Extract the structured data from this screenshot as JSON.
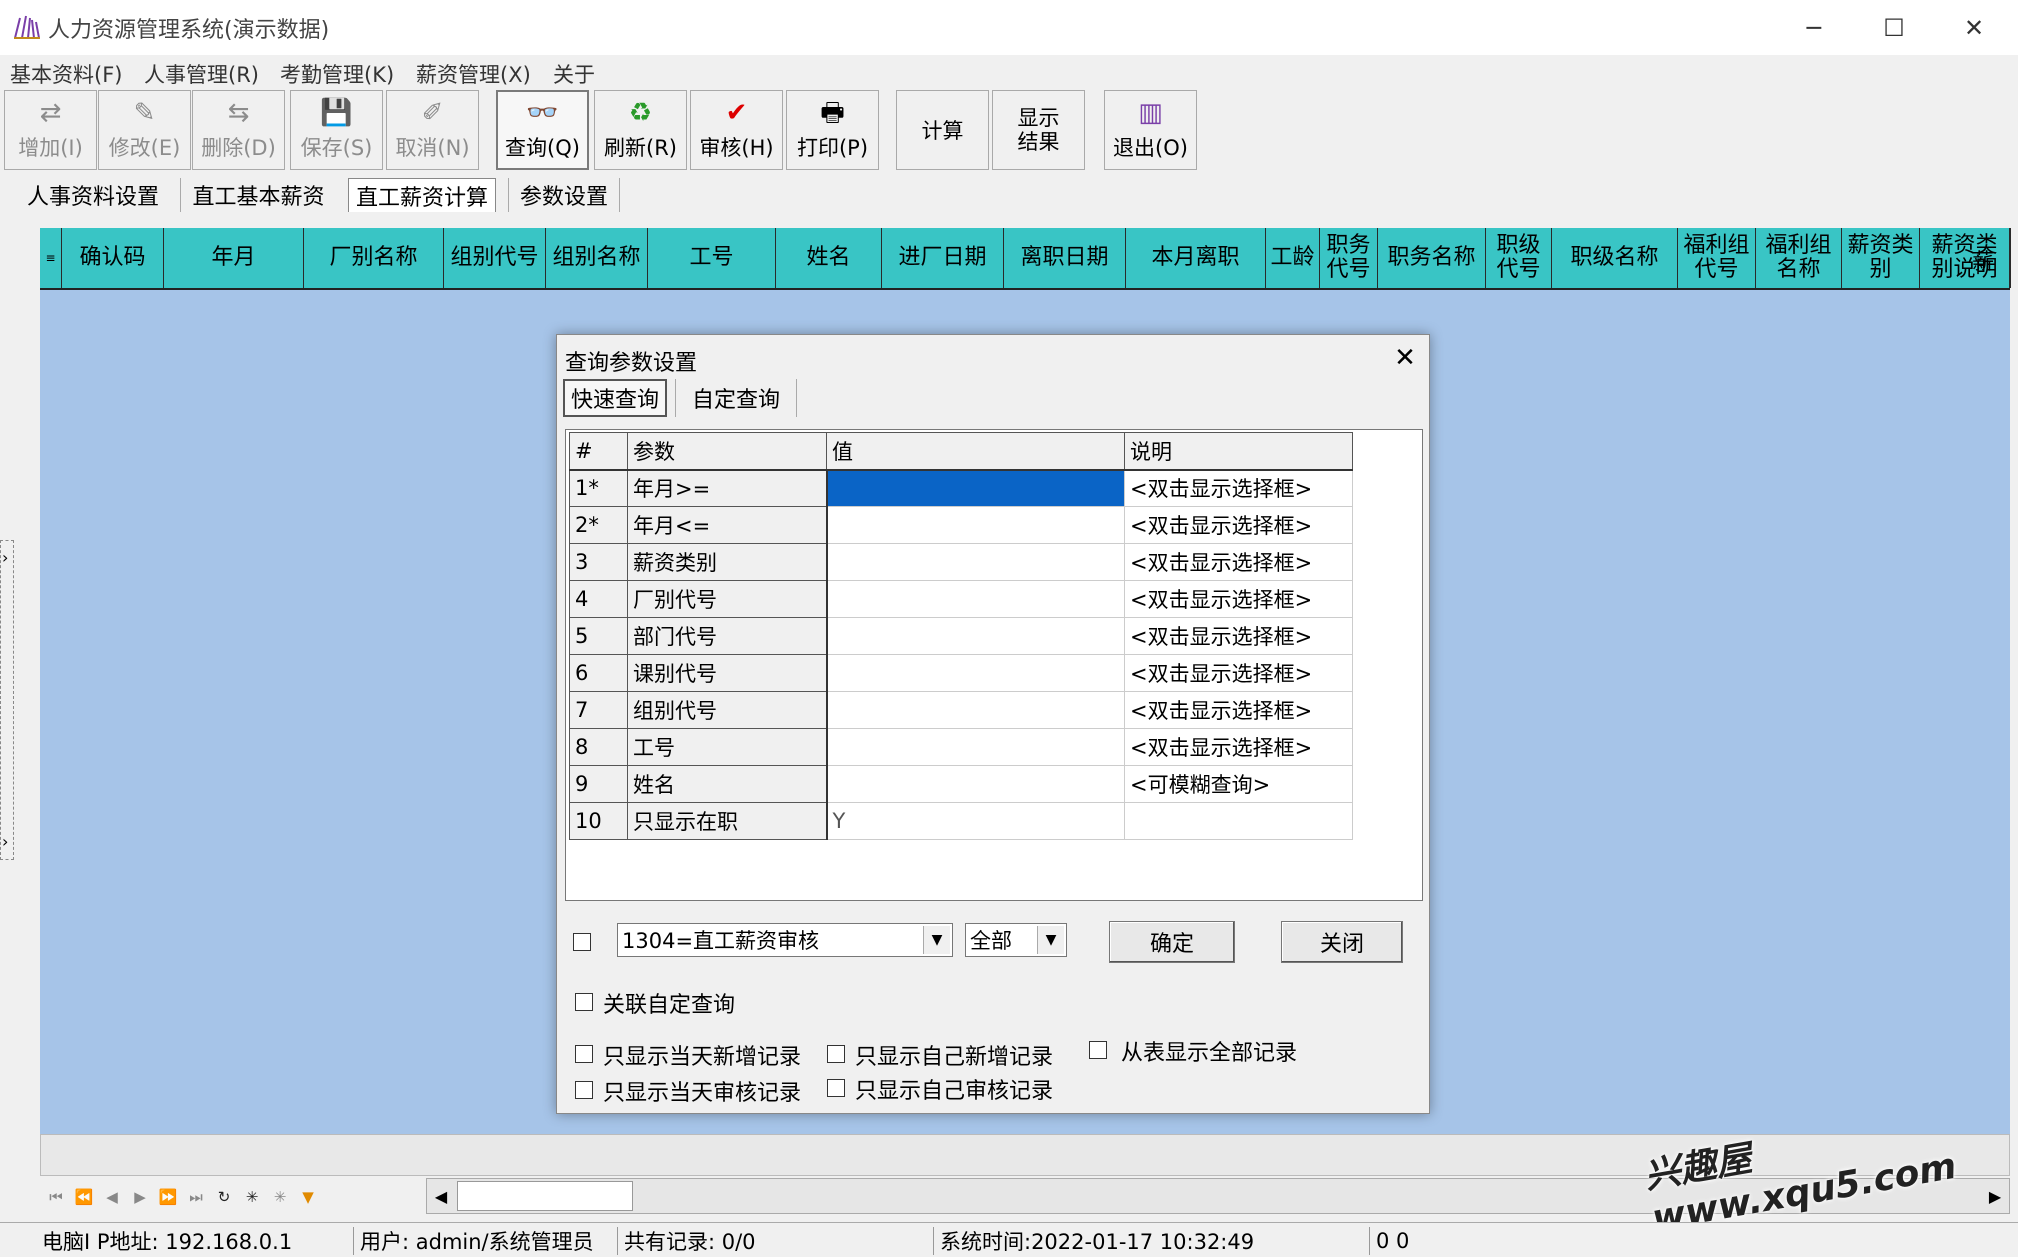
{
  "window": {
    "title": "人力资源管理系统(演示数据)",
    "min": "─",
    "max": "☐",
    "close": "✕"
  },
  "menu": [
    "基本资料(F)",
    "人事管理(R)",
    "考勤管理(K)",
    "薪资管理(X)",
    "关于"
  ],
  "toolbar": [
    {
      "label": "增加(I)",
      "icon": "add-icon",
      "glyph": "⇄",
      "disabled": true
    },
    {
      "label": "修改(E)",
      "icon": "edit-icon",
      "glyph": "✎",
      "disabled": true
    },
    {
      "label": "删除(D)",
      "icon": "delete-icon",
      "glyph": "⇆",
      "disabled": true
    },
    {
      "label": "保存(S)",
      "icon": "save-icon",
      "glyph": "💾",
      "disabled": true
    },
    {
      "label": "取消(N)",
      "icon": "cancel-icon",
      "glyph": "✐",
      "disabled": true
    },
    {
      "label": "查询(Q)",
      "icon": "binoculars-icon",
      "glyph": "👓",
      "disabled": false
    },
    {
      "label": "刷新(R)",
      "icon": "refresh-icon",
      "glyph": "♻",
      "disabled": false
    },
    {
      "label": "审核(H)",
      "icon": "check-icon",
      "glyph": "✔",
      "disabled": false
    },
    {
      "label": "打印(P)",
      "icon": "printer-icon",
      "glyph": "🖶",
      "disabled": false
    },
    {
      "label": "计算",
      "icon": "",
      "glyph": "",
      "disabled": false
    },
    {
      "label": "显示\n结果",
      "icon": "",
      "glyph": "",
      "disabled": false
    },
    {
      "label": "退出(O)",
      "icon": "exit-icon",
      "glyph": "▥",
      "disabled": false
    }
  ],
  "tabs": [
    "人事资料设置",
    "直工基本薪资",
    "直工薪资计算",
    "参数设置"
  ],
  "grid_columns": [
    "确认码",
    "年月",
    "厂别名称",
    "组别代号",
    "组别名称",
    "工号",
    "姓名",
    "进厂日期",
    "离职日期",
    "本月离职",
    "工龄",
    "职务\n代号",
    "职务名称",
    "职级\n代号",
    "职级名称",
    "福利组\n代号",
    "福利组\n名称",
    "薪资类\n别",
    "薪资类\n别说明",
    "薪"
  ],
  "dialog": {
    "title": "查询参数设置",
    "tabs": [
      "快速查询",
      "自定查询"
    ],
    "table_headers": [
      "#",
      "参数",
      "值",
      "说明"
    ],
    "rows": [
      {
        "num": "1*",
        "param": "年月>=",
        "value": "",
        "note": "<双击显示选择框>"
      },
      {
        "num": "2*",
        "param": "年月<=",
        "value": "",
        "note": "<双击显示选择框>"
      },
      {
        "num": "3",
        "param": "薪资类别",
        "value": "",
        "note": "<双击显示选择框>"
      },
      {
        "num": "4",
        "param": "厂别代号",
        "value": "",
        "note": "<双击显示选择框>"
      },
      {
        "num": "5",
        "param": "部门代号",
        "value": "",
        "note": "<双击显示选择框>"
      },
      {
        "num": "6",
        "param": "课别代号",
        "value": "",
        "note": "<双击显示选择框>"
      },
      {
        "num": "7",
        "param": "组别代号",
        "value": "",
        "note": "<双击显示选择框>"
      },
      {
        "num": "8",
        "param": "工号",
        "value": "",
        "note": "<双击显示选择框>"
      },
      {
        "num": "9",
        "param": "姓名",
        "value": "",
        "note": "<可模糊查询>"
      },
      {
        "num": "10",
        "param": "只显示在职",
        "value": "Y",
        "note": ""
      }
    ],
    "report_select": "1304=直工薪资审核",
    "scope_select": "全部",
    "ok": "确定",
    "close": "关闭",
    "link_custom": "关联自定查询",
    "checks": [
      "只显示当天新增记录",
      "只显示自己新增记录",
      "从表显示全部记录",
      "只显示当天审核记录",
      "只显示自己审核记录"
    ]
  },
  "status": {
    "ip": "电脑I P地址: 192.168.0.1",
    "user": "用户: admin/系统管理员",
    "records": "共有记录: 0/0",
    "time": "系统时间:2022-01-17 10:32:49",
    "extra": "0 0"
  },
  "watermark": "兴趣屋 www.xqu5.com"
}
